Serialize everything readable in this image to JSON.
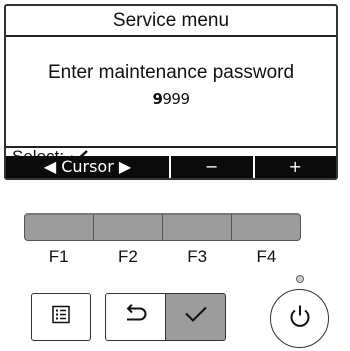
{
  "screen": {
    "title": "Service menu",
    "message": "Enter maintenance password",
    "password_cursor_digit": "9",
    "password_rest": "999",
    "select_label": "Select:",
    "select_icon": "check-icon"
  },
  "softkeys": {
    "cursor": "◀ Cursor ▶",
    "minus": "−",
    "plus": "+"
  },
  "function_keys": [
    "F1",
    "F2",
    "F3",
    "F4"
  ],
  "buttons": {
    "menu_icon": "menu-list-icon",
    "back_icon": "return-arrow-icon",
    "ok_icon": "check-icon",
    "power_icon": "power-icon"
  },
  "colors": {
    "key_gray": "#9c9c9c",
    "softkey_bar": "#0b0b0b"
  }
}
